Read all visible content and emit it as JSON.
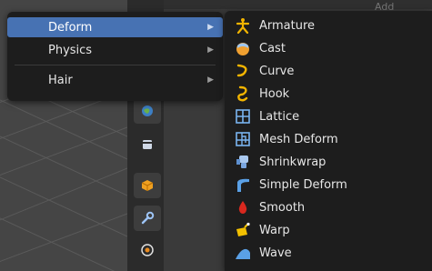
{
  "header": {
    "ghost_text": "Add Modifier"
  },
  "main_menu": {
    "items": [
      {
        "label": "Deform",
        "active": true
      },
      {
        "label": "Physics",
        "active": false
      },
      {
        "label": "Hair",
        "active": false
      }
    ],
    "arrow_glyph": "▶"
  },
  "deform_submenu": {
    "items": [
      {
        "label": "Armature",
        "icon": "armature-icon"
      },
      {
        "label": "Cast",
        "icon": "cast-icon"
      },
      {
        "label": "Curve",
        "icon": "curve-icon"
      },
      {
        "label": "Hook",
        "icon": "hook-icon"
      },
      {
        "label": "Lattice",
        "icon": "lattice-icon"
      },
      {
        "label": "Mesh Deform",
        "icon": "mesh-deform-icon"
      },
      {
        "label": "Shrinkwrap",
        "icon": "shrinkwrap-icon"
      },
      {
        "label": "Simple Deform",
        "icon": "simple-deform-icon"
      },
      {
        "label": "Smooth",
        "icon": "smooth-icon"
      },
      {
        "label": "Warp",
        "icon": "warp-icon"
      },
      {
        "label": "Wave",
        "icon": "wave-icon"
      }
    ]
  },
  "colors": {
    "menu_bg": "#1d1d1d",
    "highlight": "#4772b3",
    "text": "#e6e6e6",
    "icon_yellow": "#f2b400",
    "icon_blue": "#5aa0e6",
    "icon_red": "#d9281e"
  }
}
